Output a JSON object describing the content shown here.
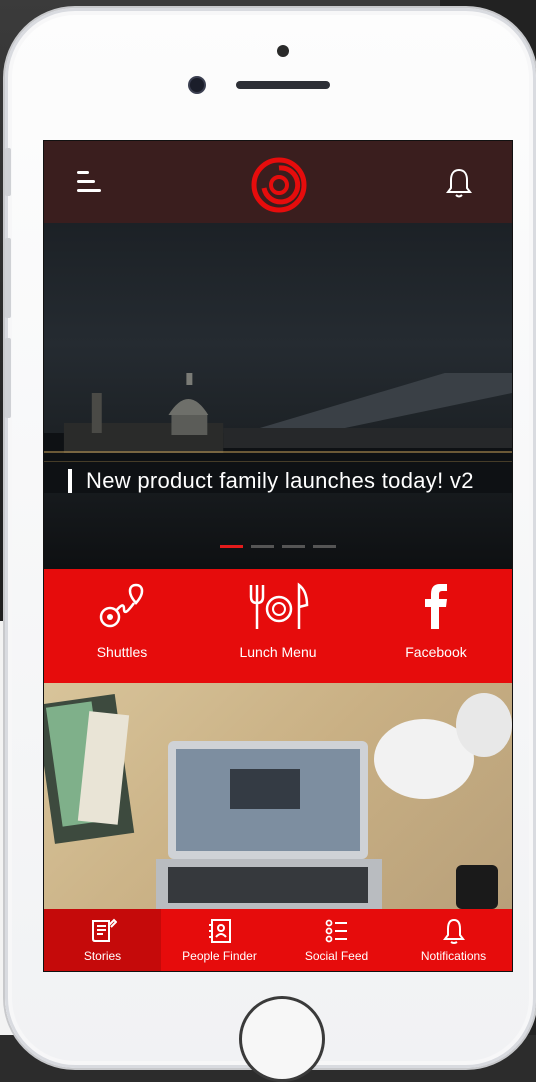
{
  "header": {
    "menu_icon": "hamburger-icon",
    "logo_icon": "ring-logo-icon",
    "bell_icon": "bell-icon",
    "bar_color": "#3a1e1e"
  },
  "hero": {
    "headline": "New product family launches today! v2",
    "slides": 4,
    "active_slide": 1
  },
  "quick_links": [
    {
      "label": "Shuttles",
      "icon": "route-pin-icon"
    },
    {
      "label": "Lunch Menu",
      "icon": "utensils-icon"
    },
    {
      "label": "Facebook",
      "icon": "facebook-icon"
    }
  ],
  "tabs": [
    {
      "label": "Stories",
      "icon": "stories-icon",
      "active": true
    },
    {
      "label": "People Finder",
      "icon": "contact-book-icon",
      "active": false
    },
    {
      "label": "Social Feed",
      "icon": "list-icon",
      "active": false
    },
    {
      "label": "Notifications",
      "icon": "bell-icon",
      "active": false
    }
  ],
  "colors": {
    "accent": "#e60c0c",
    "accent_dark": "#c50a0a",
    "header": "#3a1e1e"
  }
}
